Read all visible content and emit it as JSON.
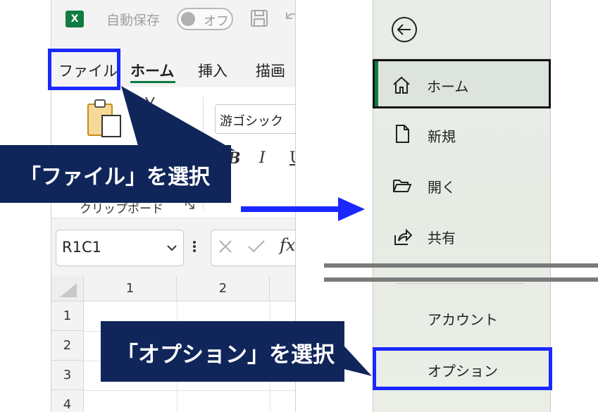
{
  "excel": {
    "logo": "X",
    "autosave_label": "自動保存",
    "autosave_toggle": "オフ",
    "tabs": [
      "ファイル",
      "ホーム",
      "挿入",
      "描画"
    ],
    "active_tab": "ホーム",
    "font_name": "游ゴシック",
    "format_buttons": [
      "B",
      "I",
      "U"
    ],
    "clipboard_group": "クリップボード",
    "name_box": "R1C1",
    "formula_fx": "fx",
    "columns": [
      "1",
      "2"
    ],
    "rows": [
      "1",
      "2",
      "3",
      "4"
    ],
    "icons": [
      "excel-logo-icon",
      "save-icon",
      "undo-icon",
      "paste-icon",
      "cut-icon",
      "dialog-launcher-icon",
      "chevron-down-icon",
      "more-dots-icon",
      "cancel-x-icon",
      "enter-check-icon"
    ]
  },
  "callouts": {
    "file": "「ファイル」を選択",
    "options": "「オプション」を選択"
  },
  "backstage": {
    "back_icon": "back-arrow-icon",
    "items": [
      {
        "label": "ホーム",
        "icon": "home-icon"
      },
      {
        "label": "新規",
        "icon": "new-document-icon"
      },
      {
        "label": "開く",
        "icon": "folder-open-icon"
      },
      {
        "label": "共有",
        "icon": "share-icon"
      }
    ],
    "account": "アカウント",
    "options": "オプション"
  },
  "colors": {
    "excel_green": "#107c41",
    "highlight_blue": "#1b27ff",
    "callout_navy": "#10265a",
    "arrow_blue": "#1b27ff",
    "omission_gray": "#7a7a7a"
  }
}
